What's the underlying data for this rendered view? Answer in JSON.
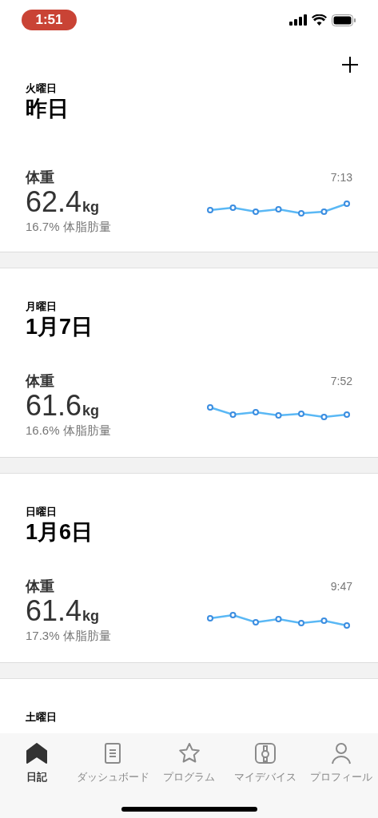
{
  "status_bar": {
    "time": "1:51"
  },
  "entries": [
    {
      "weekday": "火曜日",
      "date": "昨日",
      "metric": "体重",
      "value": "62.4",
      "unit": "kg",
      "time": "7:13",
      "body_fat": "16.7% 体脂肪量"
    },
    {
      "weekday": "月曜日",
      "date": "1月7日",
      "metric": "体重",
      "value": "61.6",
      "unit": "kg",
      "time": "7:52",
      "body_fat": "16.6% 体脂肪量"
    },
    {
      "weekday": "日曜日",
      "date": "1月6日",
      "metric": "体重",
      "value": "61.4",
      "unit": "kg",
      "time": "9:47",
      "body_fat": "17.3% 体脂肪量"
    },
    {
      "weekday": "土曜日"
    }
  ],
  "tab_bar": [
    {
      "label": "日記",
      "selected": true
    },
    {
      "label": "ダッシュボード",
      "selected": false
    },
    {
      "label": "プログラム",
      "selected": false
    },
    {
      "label": "マイデバイス",
      "selected": false
    },
    {
      "label": "プロフィール",
      "selected": false
    }
  ]
}
